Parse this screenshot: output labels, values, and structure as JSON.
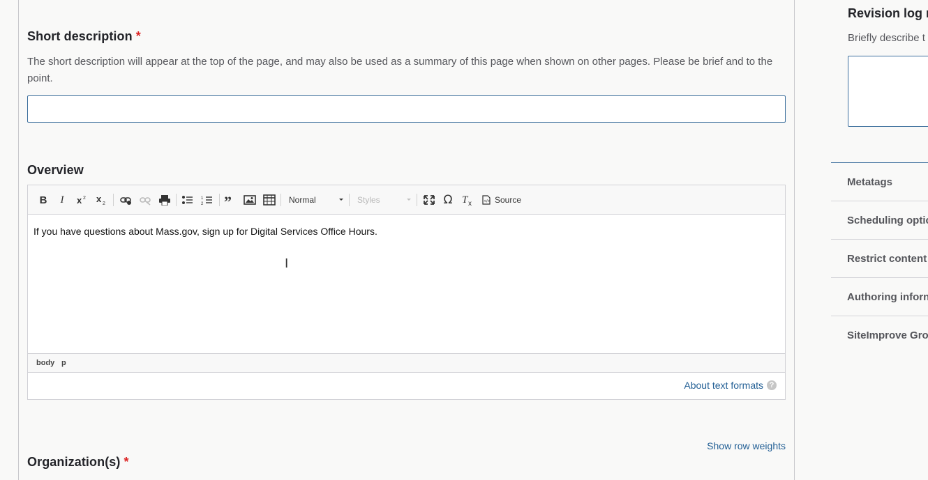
{
  "short_description": {
    "label": "Short description",
    "required_mark": "*",
    "help_text": "The short description will appear at the top of the page, and may also be used as a summary of this page when shown on other pages. Please be brief and to the point.",
    "value": ""
  },
  "overview": {
    "label": "Overview",
    "toolbar": {
      "bold": "B",
      "italic": "I",
      "format_select": "Normal",
      "styles_select": "Styles",
      "source": "Source"
    },
    "content": "If you have questions about Mass.gov, sign up for Digital Services Office Hours.",
    "path": [
      "body",
      "p"
    ],
    "about_formats": "About text formats",
    "help_icon": "?"
  },
  "row_weights_link": "Show row weights",
  "organizations": {
    "label": "Organization(s)",
    "required_mark": "*"
  },
  "sidebar": {
    "revision_title": "Revision log m",
    "revision_desc": "Briefly describe t",
    "items": [
      {
        "label": "Metatags"
      },
      {
        "label": "Scheduling optic"
      },
      {
        "label": "Restrict content"
      },
      {
        "label": "Authoring inforn"
      },
      {
        "label": "SiteImprove Gro"
      }
    ]
  },
  "colors": {
    "link": "#225f95",
    "required": "#dc2323",
    "focus_border": "#3b6e9c"
  }
}
